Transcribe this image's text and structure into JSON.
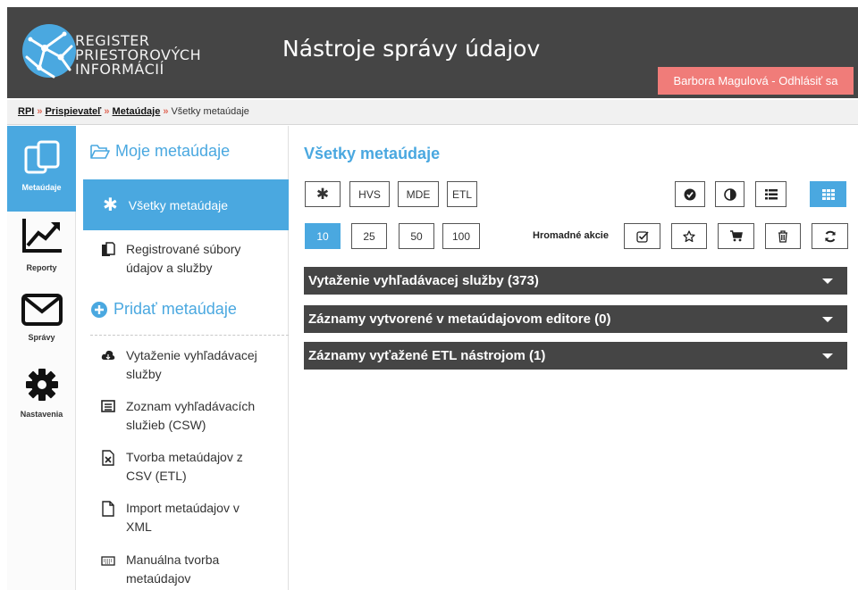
{
  "header": {
    "logo_lines": [
      "REGISTER",
      "PRIESTOROVÝCH",
      "INFORMÁCIÍ"
    ],
    "app_title": "Nástroje správy údajov",
    "user_label": "Barbora Magulová - Odhlásiť sa"
  },
  "breadcrumb": {
    "items": [
      "RPI",
      "Prispievateľ",
      "Metaúdaje"
    ],
    "separator": "»",
    "current": "Všetky metaúdaje"
  },
  "rail": {
    "items": [
      {
        "label": "Metaúdaje",
        "icon": "copy-icon",
        "active": true
      },
      {
        "label": "Reporty",
        "icon": "chart-icon",
        "active": false
      },
      {
        "label": "Správy",
        "icon": "envelope-icon",
        "active": false
      },
      {
        "label": "Nastavenia",
        "icon": "gear-icon",
        "active": false
      }
    ]
  },
  "menu": {
    "my_heading": "Moje metaúdaje",
    "active_item": "Všetky metaúdaje",
    "registered_item": [
      "Registrované súbory",
      "údajov a služby"
    ],
    "add_heading": "Pridať metaúdaje",
    "add_items": [
      {
        "lines": [
          "Vytaženie vyhľadávacej",
          "služby"
        ],
        "icon": "cloud-icon"
      },
      {
        "lines": [
          "Zoznam vyhľadávacích",
          "služieb (CSW)"
        ],
        "icon": "list-icon"
      },
      {
        "lines": [
          "Tvorba metaúdajov z",
          "CSV (ETL)"
        ],
        "icon": "excel-file-icon"
      },
      {
        "lines": [
          "Import metaúdajov v",
          "XML"
        ],
        "icon": "file-icon"
      },
      {
        "lines": [
          "Manuálna tvorba",
          "metaúdajov"
        ],
        "icon": "keyboard-icon"
      }
    ]
  },
  "main": {
    "title": "Všetky metaúdaje",
    "filters": [
      "✱",
      "HVS",
      "MDE",
      "ETL"
    ],
    "page_sizes": [
      "10",
      "25",
      "50",
      "100"
    ],
    "selected_page_size": "10",
    "bulk_label": "Hromadné akcie",
    "accordions": [
      "Vytaženie vyhľadávacej služby (373)",
      "Záznamy vytvorené v metaúdajovom editore (0)",
      "Záznamy vyťažené ETL nástrojom (1)"
    ]
  },
  "colors": {
    "accent": "#4aa8e0",
    "header_bg": "#454545",
    "logout_bg": "#f07c79"
  }
}
